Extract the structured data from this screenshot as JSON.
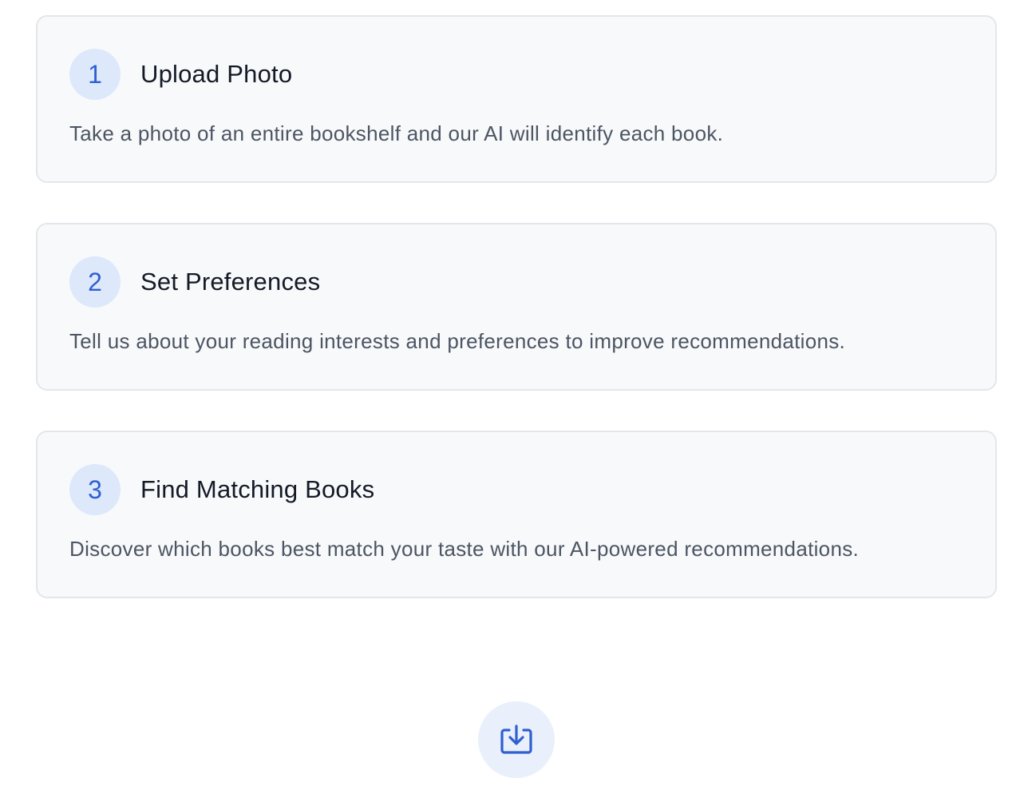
{
  "steps": [
    {
      "number": "1",
      "title": "Upload Photo",
      "description": "Take a photo of an entire bookshelf and our AI will identify each book."
    },
    {
      "number": "2",
      "title": "Set Preferences",
      "description": "Tell us about your reading interests and preferences to improve recommendations."
    },
    {
      "number": "3",
      "title": "Find Matching Books",
      "description": "Discover which books best match your taste with our AI-powered recommendations."
    }
  ],
  "action": {
    "icon": "download-tray-icon"
  },
  "colors": {
    "accent": "#2f5fd0",
    "badge_bg": "#dde8fb",
    "card_bg": "#f8f9fb",
    "card_border": "#e3e7ec"
  }
}
